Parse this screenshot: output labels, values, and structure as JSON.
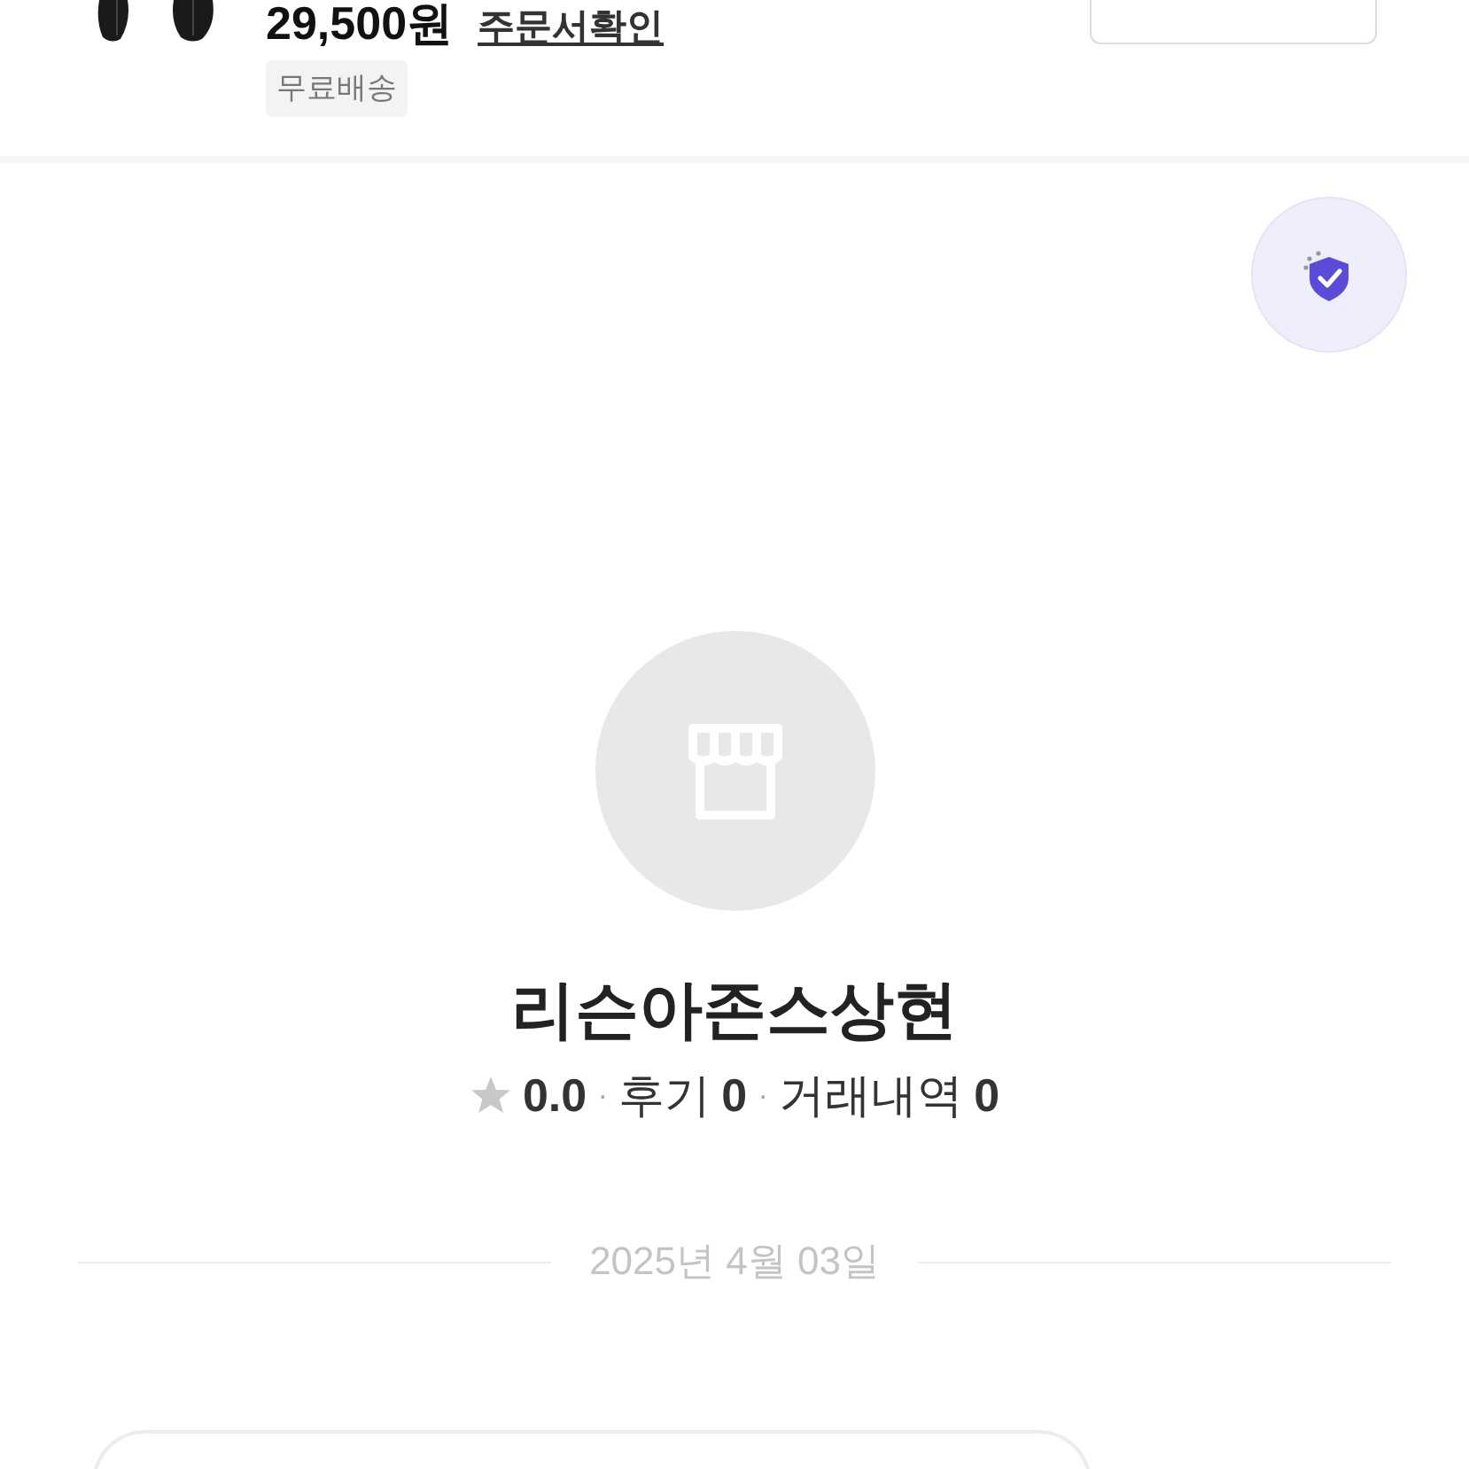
{
  "product": {
    "price": "29,500원",
    "order_link": "주문서확인",
    "badge": "무료배송"
  },
  "store": {
    "name": "리슨아존스상현",
    "rating": "0.0",
    "separator": "·",
    "reviews_label": "후기",
    "reviews_count": "0",
    "trades_label": "거래내역",
    "trades_count": "0"
  },
  "date": "2025년 4월 03일"
}
